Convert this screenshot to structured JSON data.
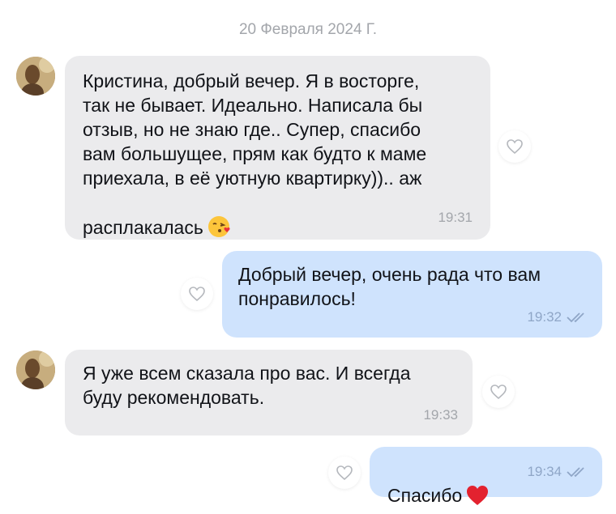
{
  "chat": {
    "date_separator": "20 Февраля 2024 Г.",
    "messages": [
      {
        "direction": "incoming",
        "text": "Кристина, добрый вечер. Я в восторге,\nтак не бывает. Идеально. Написала бы\nотзыв, но не знаю где.. Супер, спасибо\nвам большущее,  прям как будто к маме\nприехала,  в её уютную квартирку)).. аж\nрасплакалась",
        "emoji": "face-blowing-kiss",
        "time": "19:31"
      },
      {
        "direction": "outgoing",
        "text": "Добрый вечер, очень рада что вам\nпонравилось!",
        "time": "19:32",
        "status": "read"
      },
      {
        "direction": "incoming",
        "text": "Я уже всем сказала про вас. И всегда\nбуду рекомендовать.",
        "time": "19:33"
      },
      {
        "direction": "outgoing",
        "text": "Спасибо",
        "emoji": "red-heart",
        "time": "19:34",
        "status": "read"
      }
    ]
  },
  "colors": {
    "incoming_bubble": "#ebebed",
    "outgoing_bubble": "#cfe3fd",
    "meta_text": "#a3a6ab"
  },
  "icons": {
    "like": "heart-outline-icon",
    "read_status": "double-check-icon",
    "avatar": "user-photo"
  }
}
